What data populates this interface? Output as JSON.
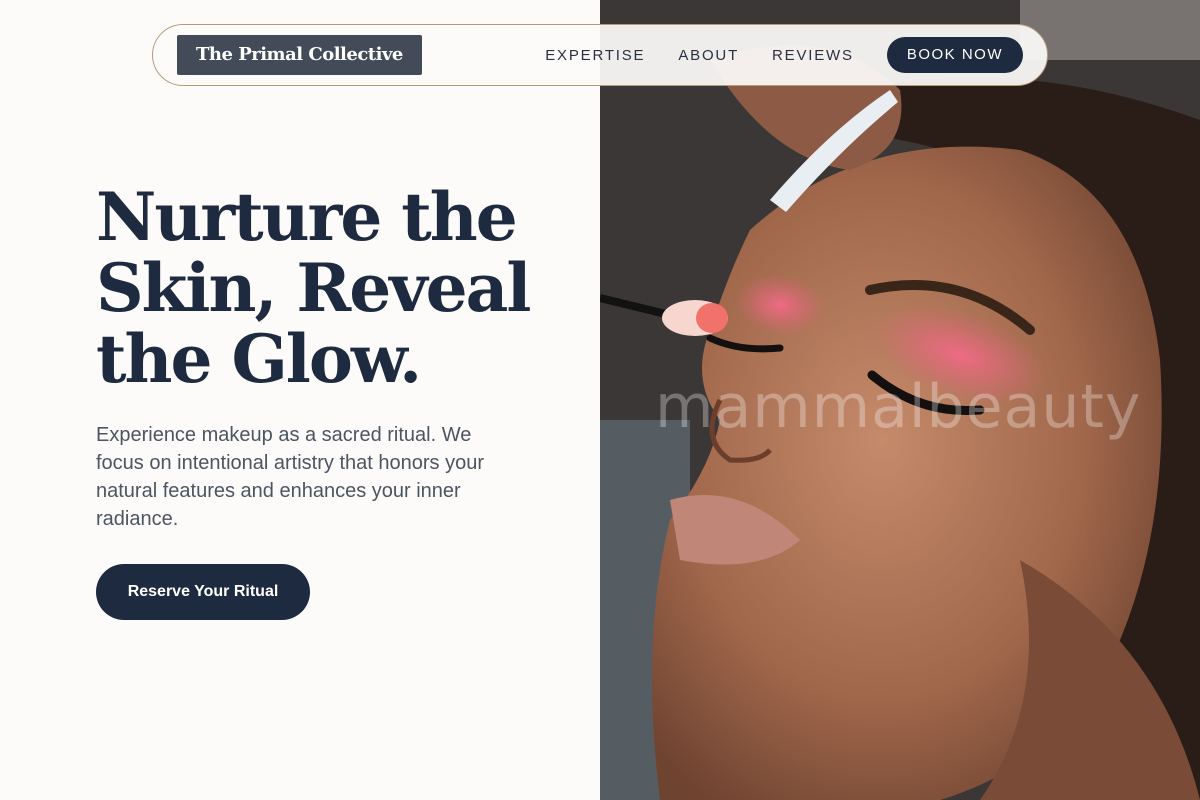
{
  "brand": {
    "name": "The Primal Collective"
  },
  "nav": {
    "links": [
      "EXPERTISE",
      "ABOUT",
      "REVIEWS"
    ],
    "book_label": "BOOK NOW"
  },
  "hero": {
    "title": "Nurture the Skin, Reveal the Glow.",
    "description": "Experience makeup as a sacred ritual. We focus on intentional artistry that honors your natural features and enhances your inner radiance.",
    "cta_label": "Reserve Your Ritual"
  },
  "photo": {
    "watermark": "mammalbeauty",
    "subject": "makeup-artist-applying-pink-eyeshadow"
  },
  "colors": {
    "background": "#fcfbf9",
    "navy": "#1e2a3f",
    "logo_bg": "#434b58",
    "nav_border": "#b49a78",
    "body_text": "#4d5562"
  }
}
